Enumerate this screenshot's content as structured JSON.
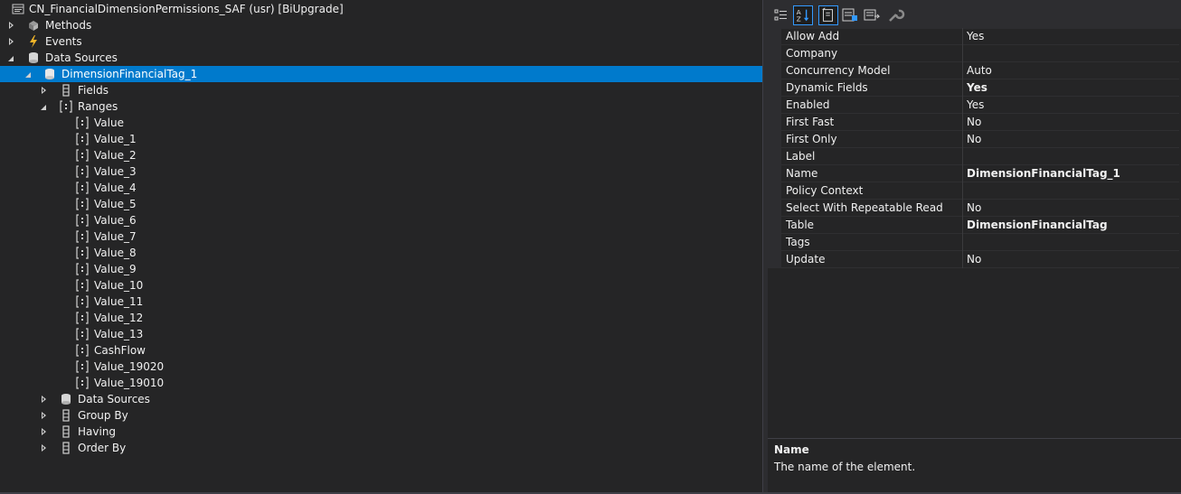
{
  "tree": {
    "root": "CN_FinancialDimensionPermissions_SAF (usr) [BiUpgrade]",
    "methods": "Methods",
    "events": "Events",
    "data_sources": "Data Sources",
    "ds_item": "DimensionFinancialTag_1",
    "fields": "Fields",
    "ranges": "Ranges",
    "range_items": [
      "Value",
      "Value_1",
      "Value_2",
      "Value_3",
      "Value_4",
      "Value_5",
      "Value_6",
      "Value_7",
      "Value_8",
      "Value_9",
      "Value_10",
      "Value_11",
      "Value_12",
      "Value_13",
      "CashFlow",
      "Value_19020",
      "Value_19010"
    ],
    "sub_data_sources": "Data Sources",
    "group_by": "Group By",
    "having": "Having",
    "order_by": "Order By"
  },
  "properties": {
    "rows": [
      {
        "name": "Allow Add",
        "value": "Yes",
        "bold": false
      },
      {
        "name": "Company",
        "value": "",
        "bold": false
      },
      {
        "name": "Concurrency Model",
        "value": "Auto",
        "bold": false
      },
      {
        "name": "Dynamic Fields",
        "value": "Yes",
        "bold": true
      },
      {
        "name": "Enabled",
        "value": "Yes",
        "bold": false
      },
      {
        "name": "First Fast",
        "value": "No",
        "bold": false
      },
      {
        "name": "First Only",
        "value": "No",
        "bold": false
      },
      {
        "name": "Label",
        "value": "",
        "bold": false
      },
      {
        "name": "Name",
        "value": "DimensionFinancialTag_1",
        "bold": true
      },
      {
        "name": "Policy Context",
        "value": "",
        "bold": false
      },
      {
        "name": "Select With Repeatable Read",
        "value": "No",
        "bold": false
      },
      {
        "name": "Table",
        "value": "DimensionFinancialTag",
        "bold": true
      },
      {
        "name": "Tags",
        "value": "",
        "bold": false
      },
      {
        "name": "Update",
        "value": "No",
        "bold": false
      }
    ],
    "description_title": "Name",
    "description_text": "The name of the element."
  },
  "colors": {
    "selection": "#007acc",
    "background": "#252526",
    "toolbar_active": "#3399ff"
  }
}
